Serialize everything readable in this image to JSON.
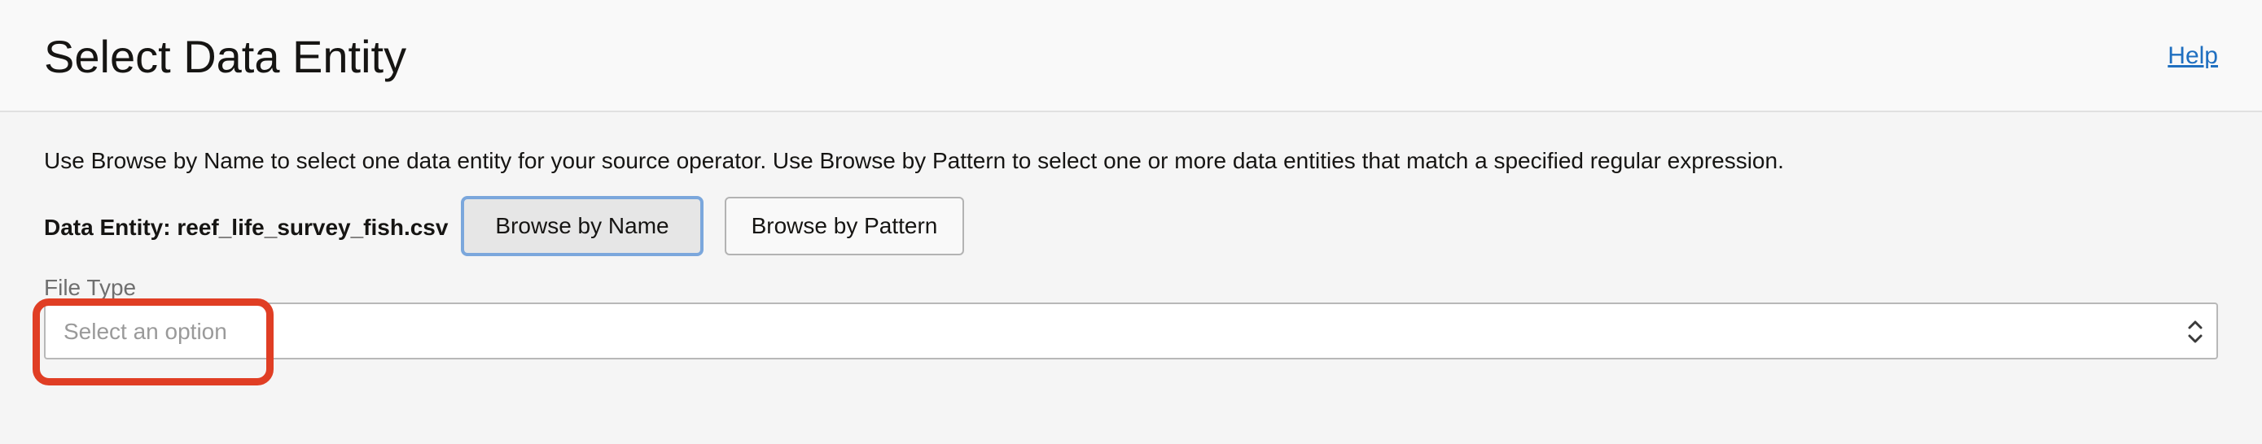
{
  "header": {
    "title": "Select Data Entity",
    "help_label": "Help"
  },
  "main": {
    "description": "Use Browse by Name to select one data entity for your source operator. Use Browse by Pattern to select one or more data entities that match a specified regular expression.",
    "data_entity_label": "Data Entity: reef_life_survey_fish.csv",
    "browse_by_name_label": "Browse by Name",
    "browse_by_pattern_label": "Browse by Pattern",
    "file_type": {
      "label": "File Type",
      "placeholder": "Select an option",
      "value": ""
    }
  },
  "colors": {
    "link": "#1f6fc0",
    "highlight": "#e03e24",
    "active_button_border": "#7ba7dc"
  },
  "icons": {
    "select_arrows": "chevron-up-down-icon"
  }
}
